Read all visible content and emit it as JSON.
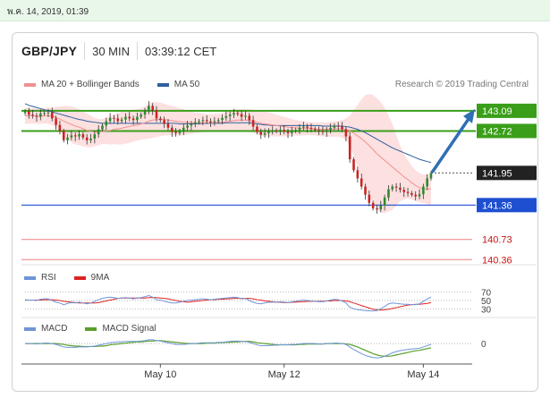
{
  "topbar": {
    "date": "พ.ค. 14, 2019, 01:39"
  },
  "header": {
    "pair": "GBP/JPY",
    "timeframe": "30 MIN",
    "time": "03:39:12 CET"
  },
  "legend": {
    "ma20": "MA 20 + Bollinger Bands",
    "ma50": "MA 50",
    "credit": "Research © 2019 Trading Central",
    "rsi": "RSI",
    "rsi9": "9MA",
    "macd": "MACD",
    "macd_signal": "MACD Signal"
  },
  "colors": {
    "green_level": "#3a9e1a",
    "blue_level": "#1f4fd1",
    "red_level": "#f08080",
    "ma50": "#2f5f9e",
    "ma20": "#f09090",
    "band": "#fcd6d6",
    "arrow": "#2f6fb5",
    "up_candle": "#2d8a2d",
    "down_candle": "#cc2222",
    "rsi_line": "#6f95d8",
    "rsi_ma": "#dd2222",
    "macd_line": "#6f95d8",
    "macd_signal": "#5aa02a"
  },
  "chart_data": {
    "type": "candlestick",
    "title": "GBP/JPY",
    "ylim": [
      140.2,
      143.4
    ],
    "x_tick_labels": [
      "May 10",
      "May 12",
      "May 14"
    ],
    "levels": [
      {
        "price": 143.09,
        "label": "143.09",
        "kind": "resistance",
        "style": "green"
      },
      {
        "price": 142.72,
        "label": "142.72",
        "kind": "resistance",
        "style": "green"
      },
      {
        "price": 141.95,
        "label": "141.95",
        "kind": "last",
        "style": "dark"
      },
      {
        "price": 141.36,
        "label": "141.36",
        "kind": "pivot",
        "style": "blue"
      },
      {
        "price": 140.73,
        "label": "140.73",
        "kind": "support",
        "style": "red"
      },
      {
        "price": 140.36,
        "label": "140.36",
        "kind": "support",
        "style": "red"
      }
    ],
    "target_arrow": {
      "from": 141.98,
      "to": 143.09
    },
    "closes": [
      143.08,
      143.02,
      143.0,
      142.98,
      143.04,
      143.05,
      143.06,
      142.95,
      142.83,
      142.72,
      142.55,
      142.6,
      142.64,
      142.62,
      142.66,
      142.6,
      142.55,
      142.58,
      142.66,
      142.75,
      142.82,
      142.9,
      142.96,
      142.95,
      142.9,
      142.93,
      142.98,
      142.95,
      142.92,
      142.98,
      143.02,
      143.08,
      143.18,
      143.1,
      142.95,
      142.92,
      142.85,
      142.78,
      142.7,
      142.68,
      142.72,
      142.78,
      142.82,
      142.85,
      142.88,
      142.9,
      142.92,
      142.9,
      142.88,
      142.9,
      142.92,
      142.96,
      142.99,
      143.02,
      143.05,
      143.03,
      142.98,
      143.0,
      142.92,
      142.8,
      142.7,
      142.65,
      142.68,
      142.72,
      142.73,
      142.72,
      142.74,
      142.71,
      142.68,
      142.72,
      142.74,
      142.78,
      142.8,
      142.78,
      142.76,
      142.74,
      142.72,
      142.7,
      142.74,
      142.78,
      142.82,
      142.8,
      142.75,
      142.62,
      142.2,
      142.0,
      141.85,
      141.7,
      141.55,
      141.4,
      141.3,
      141.28,
      141.35,
      141.5,
      141.65,
      141.7,
      141.68,
      141.64,
      141.6,
      141.58,
      141.55,
      141.52,
      141.56,
      141.7,
      141.85,
      141.95
    ],
    "ma20": [
      143.0,
      143.0,
      143.0,
      142.99,
      142.99,
      143.0,
      143.0,
      142.99,
      142.97,
      142.94,
      142.9,
      142.87,
      142.84,
      142.81,
      142.79,
      142.76,
      142.73,
      142.71,
      142.7,
      142.7,
      142.71,
      142.72,
      142.73,
      142.75,
      142.76,
      142.77,
      142.79,
      142.8,
      142.82,
      142.83,
      142.85,
      142.87,
      142.9,
      142.92,
      142.93,
      142.93,
      142.93,
      142.92,
      142.91,
      142.9,
      142.89,
      142.88,
      142.88,
      142.87,
      142.87,
      142.87,
      142.87,
      142.87,
      142.87,
      142.87,
      142.88,
      142.88,
      142.89,
      142.9,
      142.91,
      142.92,
      142.92,
      142.92,
      142.91,
      142.9,
      142.88,
      142.86,
      142.85,
      142.84,
      142.83,
      142.82,
      142.81,
      142.8,
      142.79,
      142.78,
      142.78,
      142.77,
      142.77,
      142.77,
      142.76,
      142.76,
      142.75,
      142.75,
      142.75,
      142.75,
      142.76,
      142.76,
      142.76,
      142.75,
      142.72,
      142.68,
      142.63,
      142.58,
      142.52,
      142.45,
      142.38,
      142.3,
      142.24,
      142.18,
      142.12,
      142.06,
      142.0,
      141.94,
      141.88,
      141.83,
      141.77,
      141.72,
      141.68,
      141.66,
      141.65,
      141.66
    ],
    "upper_band": [
      143.15,
      143.15,
      143.14,
      143.13,
      143.13,
      143.14,
      143.15,
      143.15,
      143.16,
      143.17,
      143.18,
      143.18,
      143.17,
      143.15,
      143.12,
      143.08,
      143.04,
      143.0,
      142.96,
      142.94,
      142.94,
      142.96,
      142.99,
      143.02,
      143.05,
      143.07,
      143.09,
      143.1,
      143.11,
      143.12,
      143.14,
      143.17,
      143.22,
      143.25,
      143.25,
      143.24,
      143.22,
      143.2,
      143.18,
      143.16,
      143.14,
      143.12,
      143.1,
      143.08,
      143.06,
      143.05,
      143.04,
      143.03,
      143.03,
      143.03,
      143.04,
      143.05,
      143.07,
      143.09,
      143.11,
      143.12,
      143.12,
      143.12,
      143.12,
      143.11,
      143.1,
      143.09,
      143.08,
      143.06,
      143.04,
      143.02,
      143.0,
      142.98,
      142.96,
      142.94,
      142.92,
      142.91,
      142.9,
      142.89,
      142.88,
      142.88,
      142.88,
      142.88,
      142.88,
      142.89,
      142.9,
      142.91,
      142.92,
      142.95,
      143.0,
      143.1,
      143.2,
      143.3,
      143.38,
      143.4,
      143.38,
      143.32,
      143.25,
      143.15,
      143.0,
      142.85,
      142.65,
      142.45,
      142.3,
      142.18,
      142.08,
      142.0,
      141.95,
      141.92,
      141.92,
      141.95
    ],
    "lower_band": [
      142.85,
      142.85,
      142.86,
      142.85,
      142.85,
      142.86,
      142.85,
      142.83,
      142.78,
      142.71,
      142.62,
      142.56,
      142.51,
      142.47,
      142.46,
      142.44,
      142.42,
      142.42,
      142.44,
      142.46,
      142.48,
      142.48,
      142.47,
      142.48,
      142.47,
      142.47,
      142.49,
      142.5,
      142.53,
      142.54,
      142.56,
      142.57,
      142.58,
      142.59,
      142.61,
      142.62,
      142.64,
      142.64,
      142.64,
      142.64,
      142.64,
      142.64,
      142.66,
      142.66,
      142.68,
      142.69,
      142.7,
      142.71,
      142.71,
      142.71,
      142.72,
      142.71,
      142.71,
      142.71,
      142.71,
      142.72,
      142.72,
      142.72,
      142.7,
      142.69,
      142.66,
      142.63,
      142.62,
      142.62,
      142.62,
      142.62,
      142.62,
      142.62,
      142.62,
      142.62,
      142.64,
      142.63,
      142.64,
      142.65,
      142.64,
      142.64,
      142.62,
      142.62,
      142.62,
      142.61,
      142.62,
      142.61,
      142.6,
      142.55,
      142.44,
      142.26,
      142.06,
      141.86,
      141.66,
      141.5,
      141.38,
      141.28,
      141.23,
      141.21,
      141.24,
      141.27,
      141.35,
      141.43,
      141.46,
      141.48,
      141.46,
      141.44,
      141.41,
      141.4,
      141.38,
      141.37
    ],
    "ma50": [
      143.22,
      143.19,
      143.17,
      143.15,
      143.13,
      143.11,
      143.09,
      143.07,
      143.05,
      143.03,
      143.01,
      142.99,
      142.97,
      142.95,
      142.93,
      142.92,
      142.9,
      142.89,
      142.88,
      142.87,
      142.86,
      142.86,
      142.86,
      142.86,
      142.86,
      142.86,
      142.86,
      142.86,
      142.86,
      142.86,
      142.86,
      142.86,
      142.86,
      142.86,
      142.86,
      142.86,
      142.86,
      142.86,
      142.86,
      142.86,
      142.85,
      142.85,
      142.85,
      142.85,
      142.85,
      142.85,
      142.86,
      142.86,
      142.86,
      142.86,
      142.86,
      142.86,
      142.87,
      142.87,
      142.87,
      142.87,
      142.87,
      142.87,
      142.87,
      142.86,
      142.85,
      142.84,
      142.83,
      142.83,
      142.82,
      142.82,
      142.82,
      142.82,
      142.82,
      142.82,
      142.82,
      142.82,
      142.82,
      142.82,
      142.82,
      142.82,
      142.82,
      142.81,
      142.81,
      142.81,
      142.81,
      142.81,
      142.81,
      142.8,
      142.79,
      142.77,
      142.75,
      142.72,
      142.69,
      142.65,
      142.61,
      142.57,
      142.53,
      142.49,
      142.45,
      142.41,
      142.38,
      142.35,
      142.32,
      142.29,
      142.26,
      142.23,
      142.2,
      142.18,
      142.16,
      142.14
    ],
    "rsi": {
      "ylim": [
        20,
        80
      ],
      "ticks": [
        70,
        50,
        30
      ],
      "values": [
        52,
        51,
        51,
        50,
        53,
        54,
        54,
        50,
        46,
        44,
        40,
        43,
        45,
        44,
        46,
        44,
        42,
        44,
        48,
        52,
        55,
        57,
        58,
        57,
        55,
        56,
        57,
        56,
        54,
        56,
        57,
        59,
        62,
        58,
        52,
        51,
        48,
        46,
        44,
        44,
        46,
        48,
        50,
        51,
        52,
        53,
        54,
        53,
        52,
        53,
        54,
        55,
        56,
        57,
        58,
        57,
        54,
        55,
        50,
        46,
        43,
        42,
        44,
        46,
        46,
        46,
        47,
        46,
        45,
        47,
        48,
        50,
        51,
        50,
        49,
        48,
        47,
        47,
        49,
        51,
        53,
        52,
        49,
        44,
        34,
        30,
        28,
        27,
        26,
        25,
        25,
        26,
        30,
        36,
        42,
        44,
        43,
        42,
        41,
        41,
        40,
        40,
        42,
        48,
        54,
        58
      ],
      "ma9": [
        51,
        51,
        51,
        51,
        51,
        52,
        52,
        52,
        51,
        50,
        48,
        47,
        46,
        45,
        44,
        44,
        44,
        44,
        44,
        45,
        47,
        49,
        51,
        53,
        55,
        56,
        56,
        56,
        56,
        56,
        56,
        56,
        57,
        57,
        57,
        56,
        55,
        54,
        52,
        50,
        48,
        47,
        46,
        47,
        48,
        49,
        50,
        51,
        52,
        52,
        53,
        53,
        54,
        54,
        55,
        55,
        55,
        55,
        55,
        54,
        52,
        51,
        49,
        48,
        47,
        46,
        46,
        45,
        45,
        46,
        46,
        47,
        47,
        48,
        48,
        48,
        48,
        48,
        49,
        49,
        50,
        50,
        50,
        49,
        47,
        44,
        41,
        38,
        35,
        32,
        29,
        28,
        27,
        28,
        29,
        31,
        33,
        35,
        37,
        39,
        40,
        41,
        41,
        42,
        43,
        45
      ]
    },
    "macd": {
      "ylim": [
        -0.4,
        0.3
      ],
      "ticks": [
        0
      ],
      "values": [
        0.0,
        0.0,
        0.0,
        -0.01,
        0.0,
        0.01,
        0.01,
        0.0,
        -0.02,
        -0.05,
        -0.08,
        -0.09,
        -0.09,
        -0.09,
        -0.08,
        -0.08,
        -0.08,
        -0.07,
        -0.06,
        -0.04,
        -0.02,
        0.0,
        0.02,
        0.03,
        0.04,
        0.04,
        0.05,
        0.05,
        0.05,
        0.05,
        0.06,
        0.07,
        0.09,
        0.09,
        0.07,
        0.06,
        0.04,
        0.02,
        0.0,
        -0.02,
        -0.02,
        -0.02,
        -0.01,
        0.0,
        0.0,
        0.01,
        0.02,
        0.02,
        0.02,
        0.02,
        0.03,
        0.03,
        0.04,
        0.05,
        0.06,
        0.06,
        0.05,
        0.05,
        0.03,
        0.0,
        -0.03,
        -0.05,
        -0.05,
        -0.05,
        -0.04,
        -0.04,
        -0.03,
        -0.03,
        -0.03,
        -0.02,
        -0.02,
        -0.01,
        0.0,
        0.0,
        0.0,
        0.0,
        -0.01,
        -0.01,
        0.0,
        0.0,
        0.01,
        0.01,
        0.0,
        -0.02,
        -0.08,
        -0.14,
        -0.19,
        -0.24,
        -0.28,
        -0.31,
        -0.33,
        -0.34,
        -0.33,
        -0.3,
        -0.26,
        -0.22,
        -0.19,
        -0.17,
        -0.15,
        -0.14,
        -0.13,
        -0.12,
        -0.11,
        -0.08,
        -0.05,
        -0.02
      ],
      "signal": [
        0.0,
        0.0,
        0.0,
        0.0,
        0.0,
        0.0,
        0.0,
        0.0,
        0.0,
        -0.01,
        -0.02,
        -0.04,
        -0.05,
        -0.06,
        -0.06,
        -0.07,
        -0.07,
        -0.07,
        -0.07,
        -0.06,
        -0.06,
        -0.05,
        -0.03,
        -0.02,
        -0.01,
        0.0,
        0.01,
        0.02,
        0.03,
        0.04,
        0.04,
        0.05,
        0.06,
        0.06,
        0.07,
        0.07,
        0.06,
        0.05,
        0.04,
        0.03,
        0.02,
        0.01,
        0.0,
        0.0,
        0.0,
        0.0,
        0.0,
        0.01,
        0.01,
        0.01,
        0.02,
        0.02,
        0.03,
        0.03,
        0.04,
        0.04,
        0.05,
        0.05,
        0.05,
        0.04,
        0.02,
        0.01,
        0.0,
        -0.01,
        -0.02,
        -0.03,
        -0.03,
        -0.03,
        -0.03,
        -0.03,
        -0.03,
        -0.02,
        -0.02,
        -0.01,
        -0.01,
        -0.01,
        -0.01,
        -0.01,
        0.0,
        0.0,
        0.0,
        0.0,
        0.0,
        -0.01,
        -0.02,
        -0.05,
        -0.08,
        -0.12,
        -0.16,
        -0.2,
        -0.24,
        -0.27,
        -0.29,
        -0.3,
        -0.3,
        -0.29,
        -0.27,
        -0.25,
        -0.23,
        -0.21,
        -0.19,
        -0.17,
        -0.16,
        -0.14,
        -0.12,
        -0.1
      ]
    }
  }
}
